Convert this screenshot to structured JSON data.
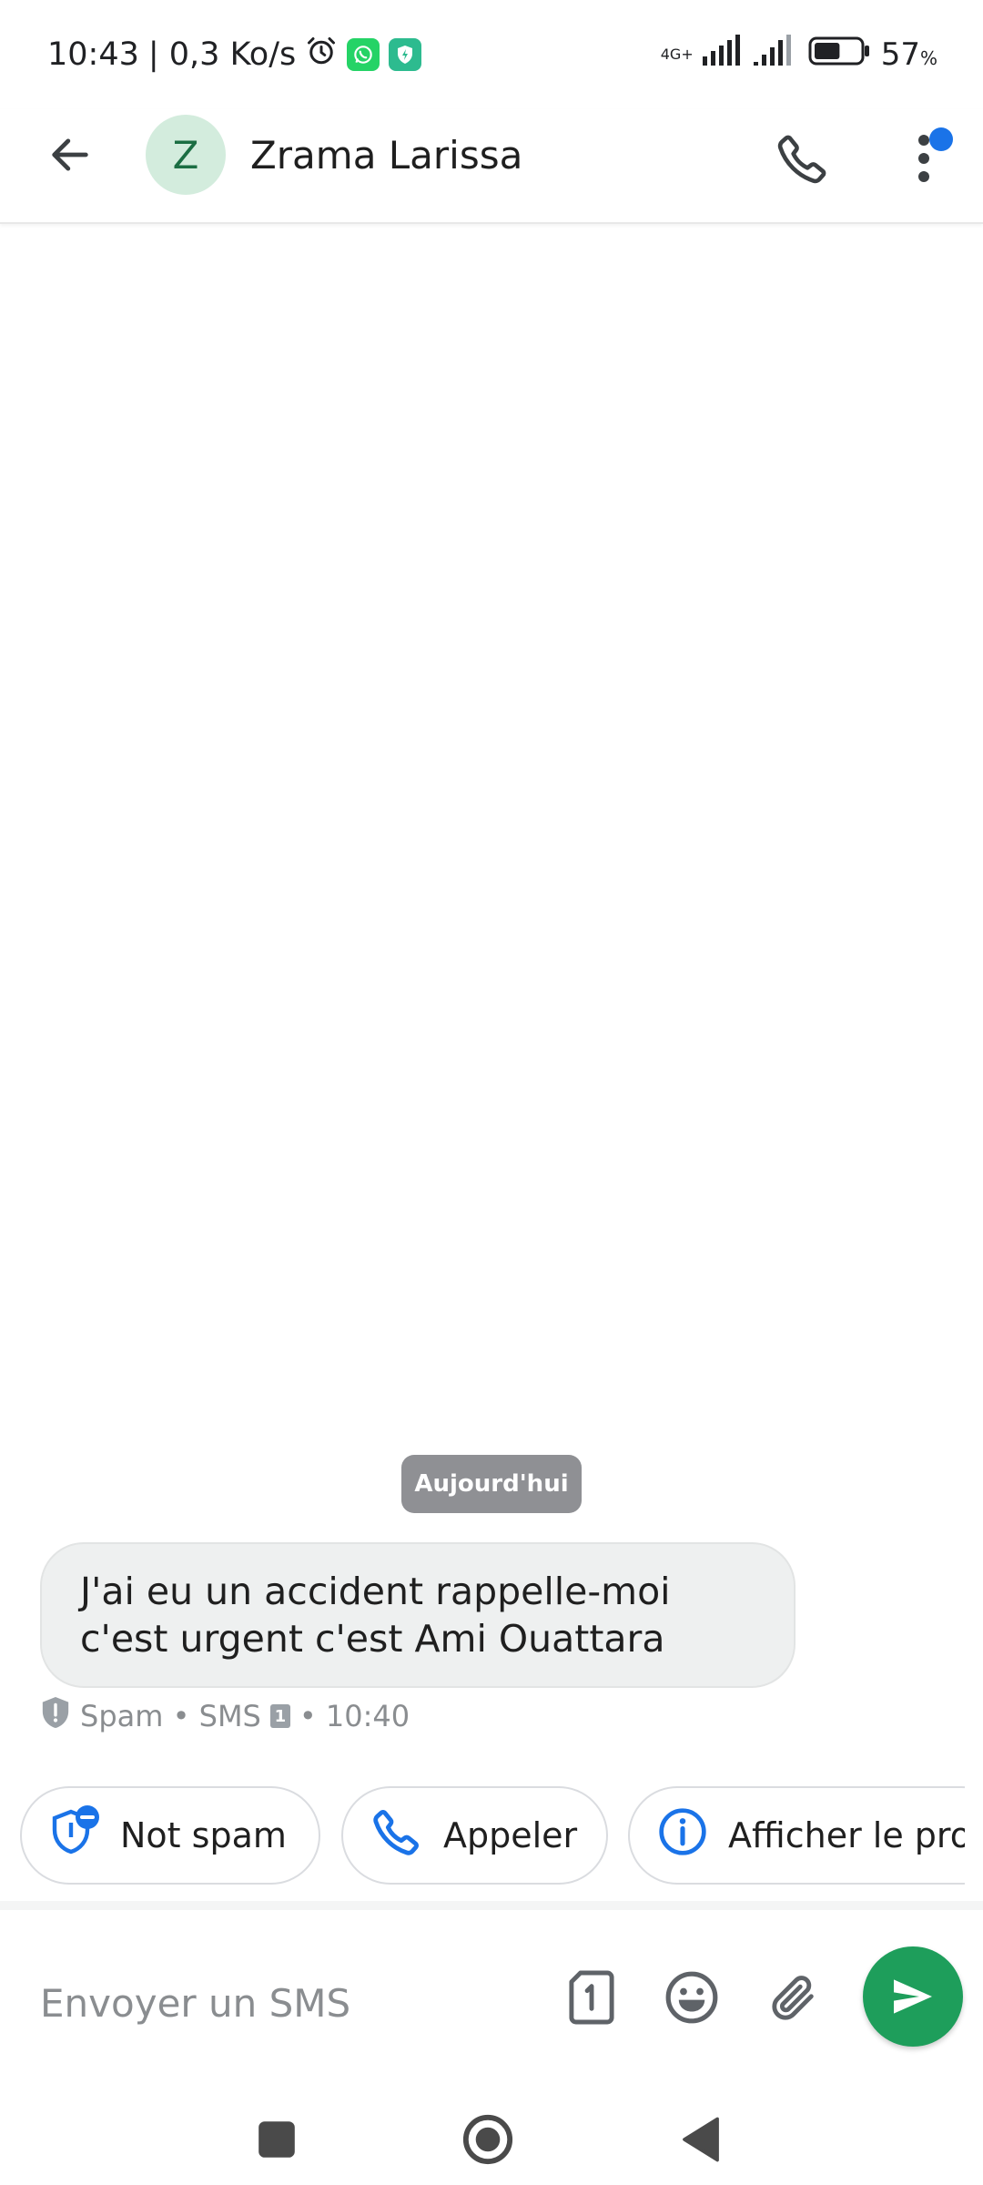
{
  "status_bar": {
    "time": "10:43",
    "net_speed": "| 0,3 Ko/s",
    "network": "4G+",
    "battery_percent": "57",
    "battery_unit": "%",
    "battery_level": 0.57
  },
  "header": {
    "avatar_letter": "Z",
    "contact_name": "Zrama Larissa"
  },
  "chat": {
    "date_label": "Aujourd'hui",
    "messages": [
      {
        "text": "J'ai eu un accident rappelle-moi c'est urgent c'est Ami Ouattara",
        "meta_type": "Spam • SMS",
        "sim": "1",
        "time": "• 10:40"
      }
    ]
  },
  "suggestions": [
    {
      "label": "Not spam",
      "icon": "shield-minus-icon"
    },
    {
      "label": "Appeler",
      "icon": "phone-icon"
    },
    {
      "label": "Afficher le prof",
      "icon": "info-icon"
    }
  ],
  "compose": {
    "placeholder": "Envoyer un SMS",
    "sim": "1"
  },
  "colors": {
    "accent_blue": "#1a73e8",
    "send_green": "#1e9e5b",
    "avatar_bg": "#d3ecdd",
    "bubble_bg": "#eef0f0"
  }
}
